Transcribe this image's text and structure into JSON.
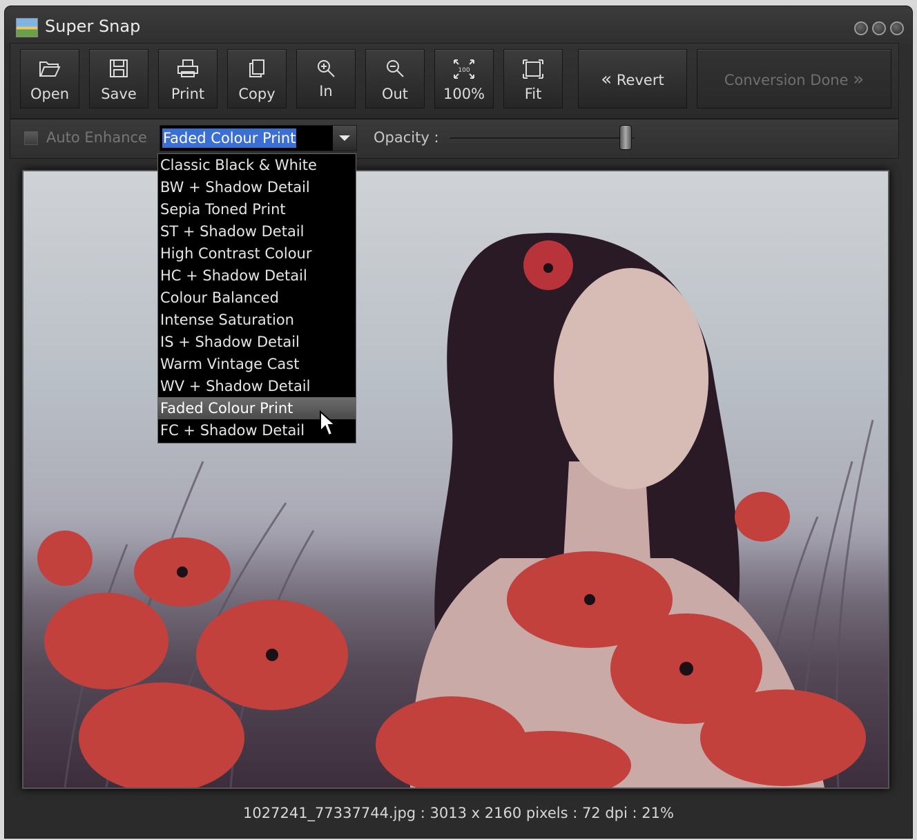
{
  "window": {
    "title": "Super Snap"
  },
  "toolbar": {
    "open": "Open",
    "save": "Save",
    "print": "Print",
    "copy": "Copy",
    "zoom_in": "In",
    "zoom_out": "Out",
    "actual_size": "100%",
    "fit": "Fit",
    "revert": "Revert",
    "conversion_done": "Conversion Done"
  },
  "options": {
    "auto_enhance": "Auto Enhance",
    "preset_selected": "Faded Colour Print",
    "opacity_label": "Opacity :",
    "opacity_fraction": 0.95
  },
  "dropdown": {
    "items": [
      "Classic Black & White",
      "BW + Shadow Detail",
      "Sepia Toned Print",
      "ST + Shadow Detail",
      "High Contrast Colour",
      "HC + Shadow Detail",
      "Colour Balanced",
      "Intense Saturation",
      "IS + Shadow Detail",
      "Warm Vintage Cast",
      "WV + Shadow Detail",
      "Faded Colour Print",
      "FC + Shadow Detail"
    ],
    "selected_index": 11
  },
  "status": {
    "text": "1027241_77337744.jpg : 3013 x 2160 pixels : 72 dpi : 21%"
  },
  "colors": {
    "accent": "#3b6fd4",
    "poppy": "#c2413c"
  }
}
